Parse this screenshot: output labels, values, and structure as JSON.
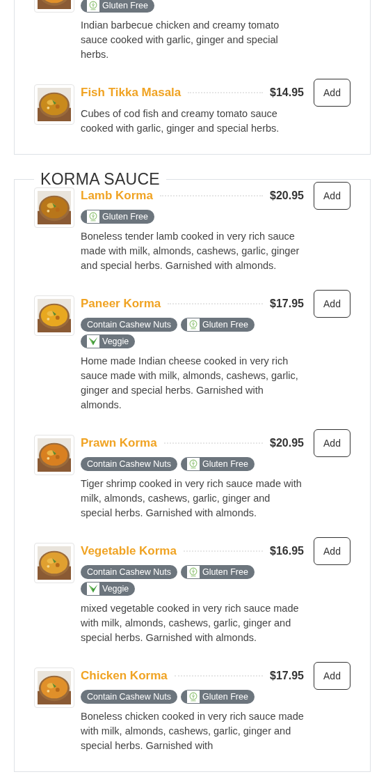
{
  "sections": [
    {
      "items": [
        {
          "badges": [
            {
              "label": "Gluten Free",
              "kind": "gluten"
            }
          ],
          "description": "Indian barbecue chicken and creamy tomato sauce cooked with garlic, ginger and special herbs."
        },
        {
          "name": "Fish Tikka Masala",
          "price": "$14.95",
          "button": "Add",
          "description": "Cubes of cod fish and creamy tomato sauce cooked with garlic, ginger and special herbs."
        }
      ]
    },
    {
      "title": "KORMA SAUCE",
      "items": [
        {
          "name": "Lamb Korma",
          "price": "$20.95",
          "button": "Add",
          "badges": [
            {
              "label": "Gluten Free",
              "kind": "gluten"
            }
          ],
          "description": "Boneless tender lamb cooked in very rich sauce made with milk, almonds, cashews, garlic, ginger and special herbs. Garnished with almonds."
        },
        {
          "name": "Paneer Korma",
          "price": "$17.95",
          "button": "Add",
          "badges": [
            {
              "label": "Contain Cashew Nuts",
              "kind": "plain"
            },
            {
              "label": "Gluten Free",
              "kind": "gluten"
            },
            {
              "label": "Veggie",
              "kind": "veggie"
            }
          ],
          "description": "Home made Indian cheese cooked in very rich sauce made with milk, almonds, cashews, garlic, ginger and special herbs. Garnished with almonds."
        },
        {
          "name": "Prawn Korma",
          "price": "$20.95",
          "button": "Add",
          "badges": [
            {
              "label": "Contain Cashew Nuts",
              "kind": "plain"
            },
            {
              "label": "Gluten Free",
              "kind": "gluten"
            }
          ],
          "description": "Tiger shrimp cooked in very rich sauce made with milk, almonds, cashews, garlic, ginger and special herbs. Garnished with almonds."
        },
        {
          "name": "Vegetable Korma",
          "price": "$16.95",
          "button": "Add",
          "badges": [
            {
              "label": "Contain Cashew Nuts",
              "kind": "plain"
            },
            {
              "label": "Gluten Free",
              "kind": "gluten"
            },
            {
              "label": "Veggie",
              "kind": "veggie"
            }
          ],
          "description": "mixed vegetable cooked in very rich sauce made with milk, almonds, cashews, garlic, ginger and special herbs. Garnished with almonds."
        },
        {
          "name": "Chicken Korma",
          "price": "$17.95",
          "button": "Add",
          "badges": [
            {
              "label": "Contain Cashew Nuts",
              "kind": "plain"
            },
            {
              "label": "Gluten Free",
              "kind": "gluten"
            }
          ],
          "description": "Boneless chicken cooked in very rich sauce made with milk, almonds, cashews, garlic, ginger and special herbs. Garnished with"
        }
      ]
    }
  ]
}
